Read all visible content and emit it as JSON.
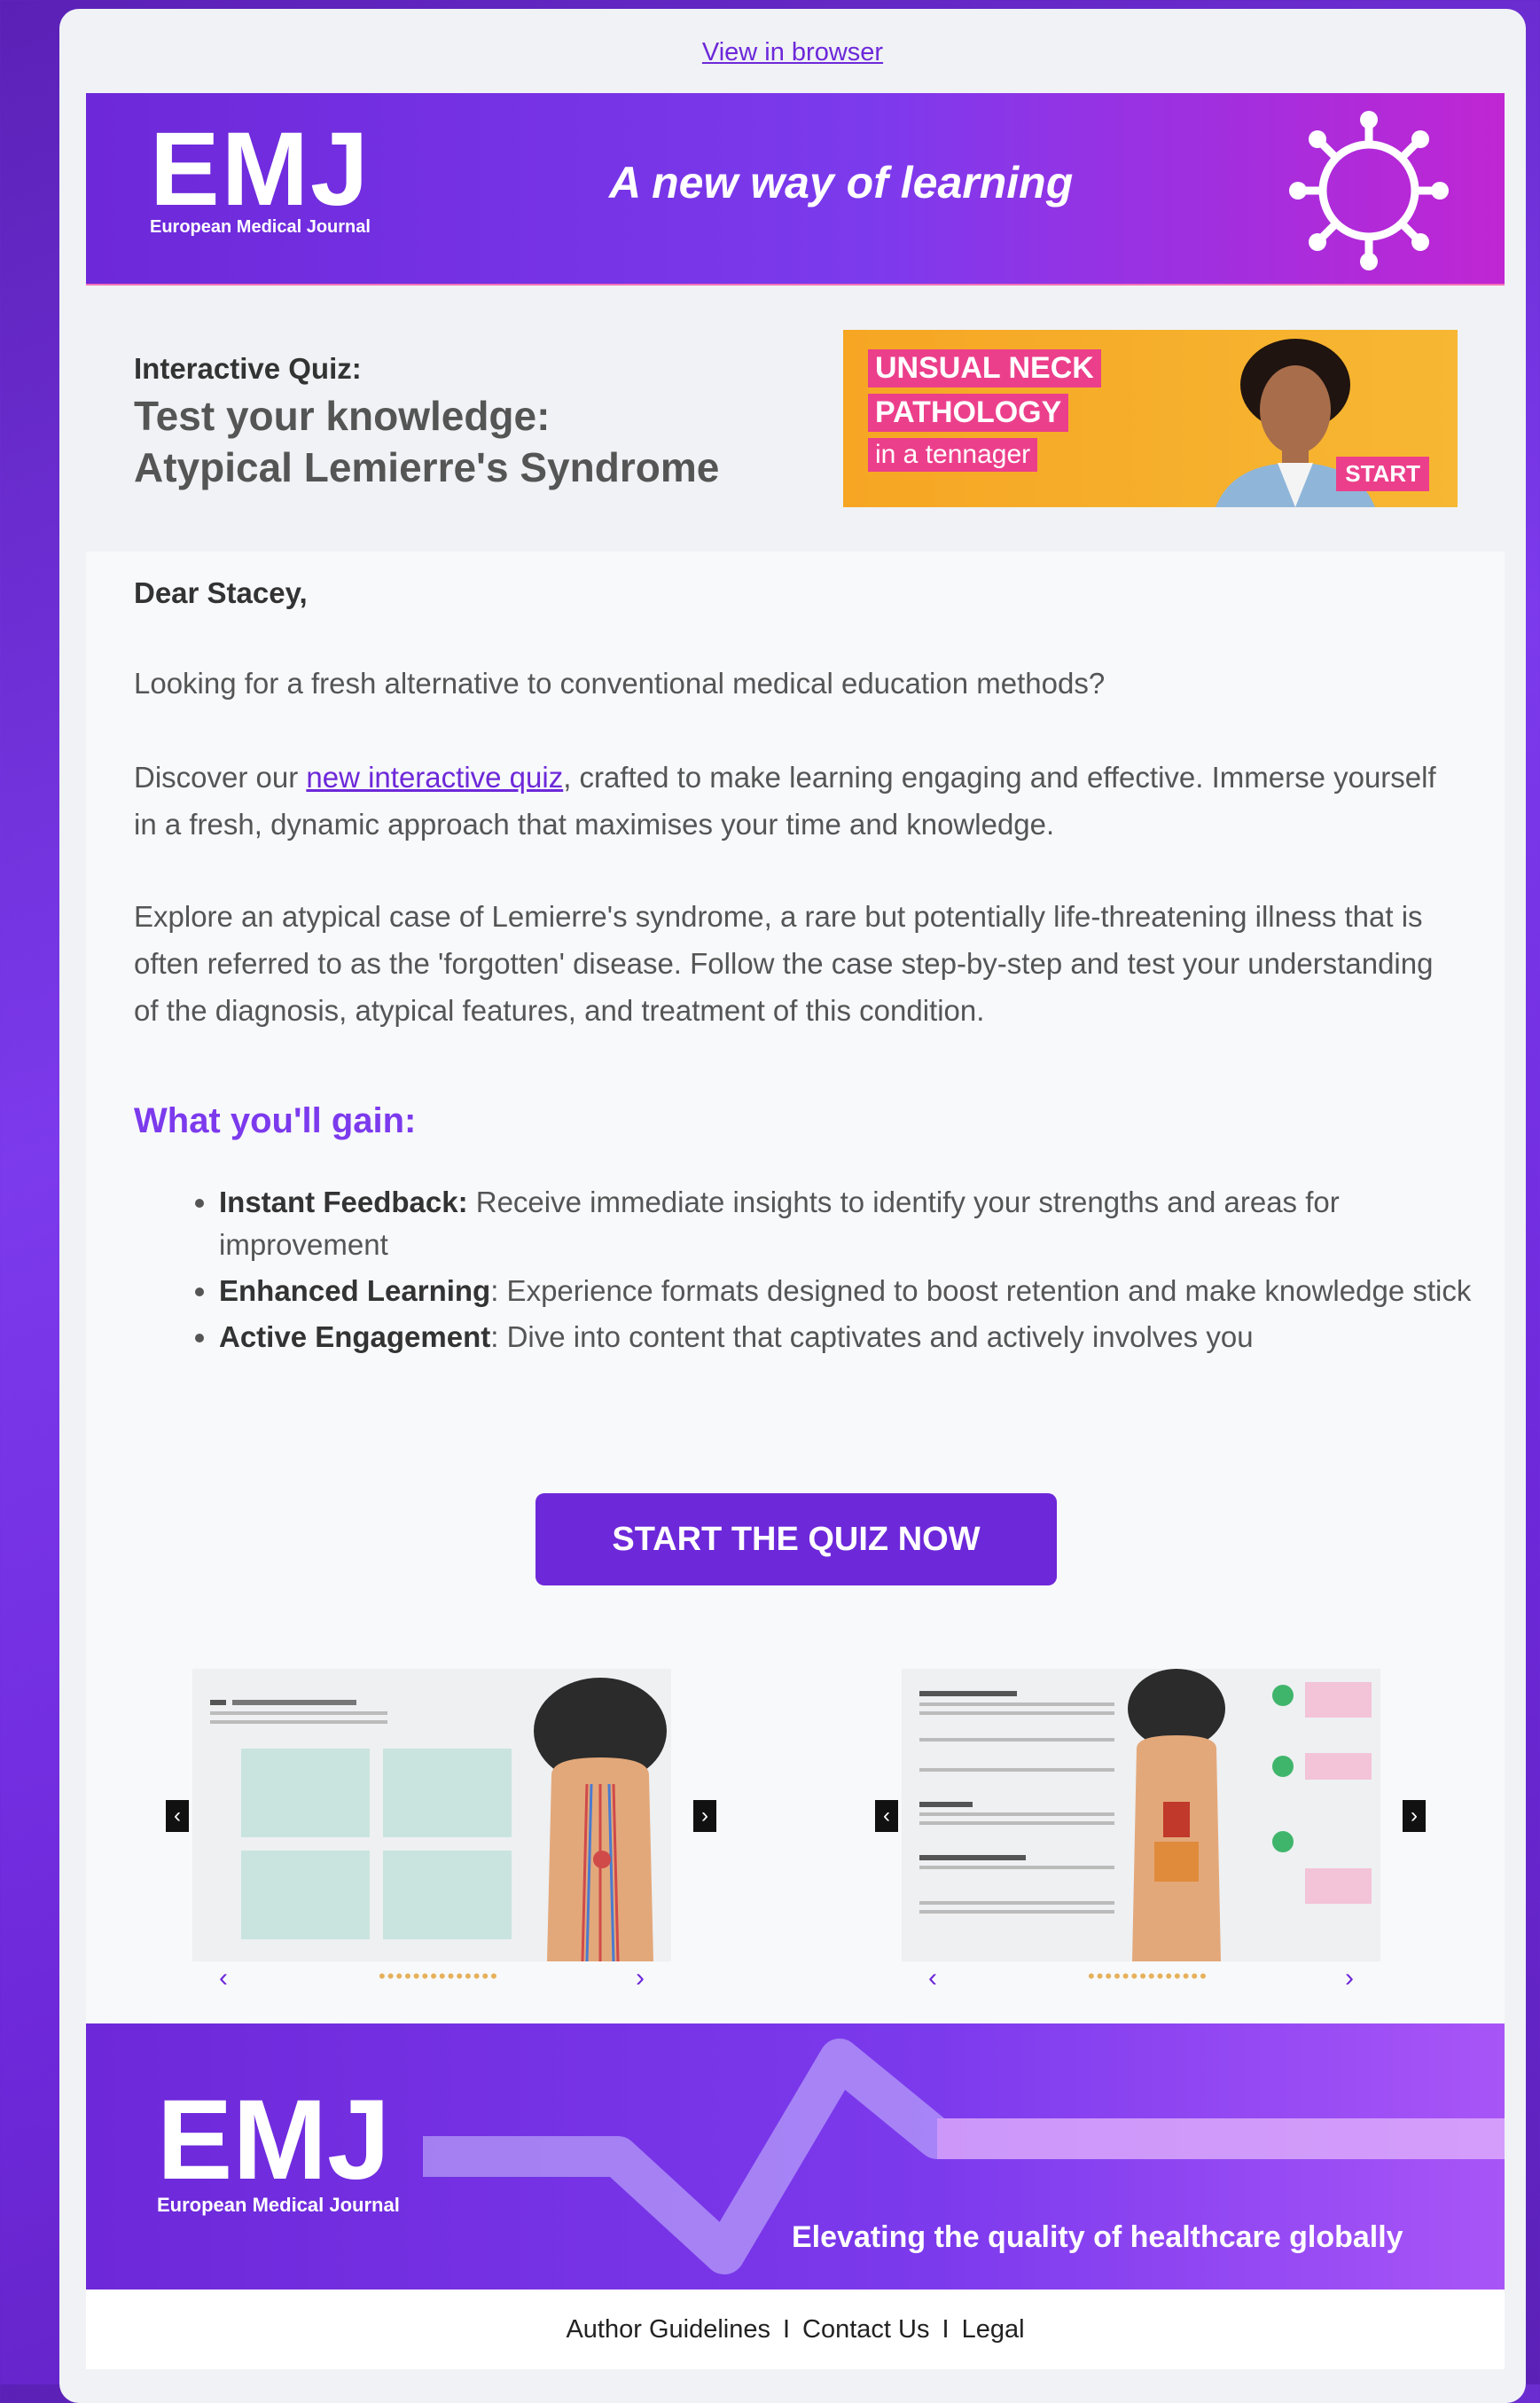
{
  "header": {
    "view_in_browser": "View in browser"
  },
  "hero": {
    "logo_mark": "EMJ",
    "logo_sub": "European Medical Journal",
    "tagline": "A new way of learning"
  },
  "quiz": {
    "label": "Interactive Quiz:",
    "title_line1": "Test your knowledge:",
    "title_line2": "Atypical Lemierre's Syndrome",
    "banner": {
      "line1": "UNSUAL NECK",
      "line2": "PATHOLOGY",
      "line3": "in a tennager",
      "start": "START"
    }
  },
  "body": {
    "greeting": "Dear Stacey,",
    "p1": "Looking for a fresh alternative to conventional medical education methods?",
    "p2_pre": "Discover our ",
    "p2_link": "new interactive quiz",
    "p2_post": ", crafted to make learning engaging and effective. Immerse yourself in a fresh, dynamic approach that maximises your time and knowledge.",
    "p3": "Explore an atypical case of Lemierre's syndrome, a rare but potentially life-threatening illness that is often referred to as the 'forgotten' disease. Follow the case step-by-step and test your understanding of the diagnosis, atypical features, and treatment of this condition.",
    "gain_heading": "What you'll gain:",
    "bullets": [
      {
        "bold": "Instant Feedback:",
        "text": " Receive immediate insights to identify your strengths and areas for improvement"
      },
      {
        "bold": "Enhanced Learning",
        "text": ": Experience formats designed to boost retention and make knowledge stick"
      },
      {
        "bold": "Active Engagement",
        "text": ": Dive into content that captivates and actively involves you"
      }
    ],
    "cta": "START THE QUIZ NOW"
  },
  "footer": {
    "logo_mark": "EMJ",
    "logo_sub": "European Medical Journal",
    "tagline": "Elevating the quality of healthcare globally",
    "links": [
      "Author Guidelines",
      "Contact Us",
      "Legal"
    ],
    "separator": "I"
  },
  "colors": {
    "brand_purple": "#6d28d9",
    "accent_pink": "#ec3f8b",
    "banner_orange": "#f6a623"
  }
}
